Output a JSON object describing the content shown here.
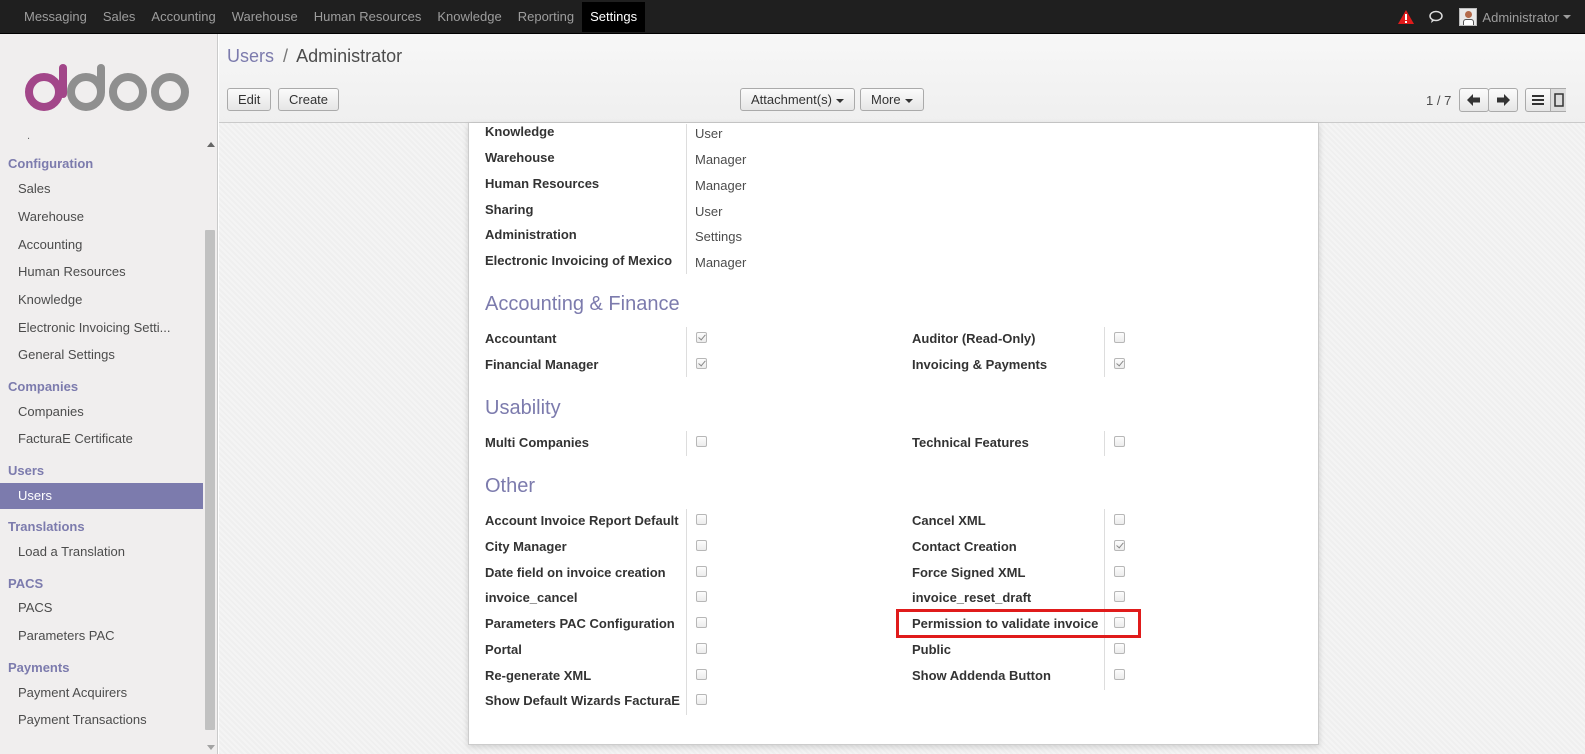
{
  "topbar": {
    "menu": [
      "Messaging",
      "Sales",
      "Accounting",
      "Warehouse",
      "Human Resources",
      "Knowledge",
      "Reporting",
      "Settings"
    ],
    "active": "Settings",
    "user": "Administrator",
    "alert_color": "#e01b1b"
  },
  "sidebar": {
    "logo": "odoo",
    "sections": [
      {
        "title": "Configuration",
        "items": [
          "Sales",
          "Warehouse",
          "Accounting",
          "Human Resources",
          "Knowledge",
          "Electronic Invoicing Setti...",
          "General Settings"
        ]
      },
      {
        "title": "Companies",
        "items": [
          "Companies",
          "FacturaE Certificate"
        ]
      },
      {
        "title": "Users",
        "items": [
          "Users"
        ]
      },
      {
        "title": "Translations",
        "items": [
          "Load a Translation"
        ]
      },
      {
        "title": "PACS",
        "items": [
          "PACS",
          "Parameters PAC"
        ]
      },
      {
        "title": "Payments",
        "items": [
          "Payment Acquirers",
          "Payment Transactions"
        ]
      }
    ],
    "active_item": "Users",
    "accent": "#7c7bad"
  },
  "control": {
    "breadcrumb_parent": "Users",
    "breadcrumb_separator": "/",
    "breadcrumb_current": "Administrator",
    "edit": "Edit",
    "create": "Create",
    "attachments": "Attachment(s)",
    "more": "More",
    "pager": "1 / 7"
  },
  "access_rights": [
    {
      "label": "Knowledge",
      "value": "User"
    },
    {
      "label": "Warehouse",
      "value": "Manager"
    },
    {
      "label": "Human Resources",
      "value": "Manager"
    },
    {
      "label": "Sharing",
      "value": "User"
    },
    {
      "label": "Administration",
      "value": "Settings"
    },
    {
      "label": "Electronic Invoicing of Mexico",
      "value": "Manager"
    }
  ],
  "groups": [
    {
      "title": "Accounting & Finance",
      "rows": [
        [
          {
            "label": "Accountant",
            "checked": true
          },
          {
            "label": "Auditor (Read-Only)",
            "checked": false
          }
        ],
        [
          {
            "label": "Financial Manager",
            "checked": true
          },
          {
            "label": "Invoicing & Payments",
            "checked": true
          }
        ]
      ]
    },
    {
      "title": "Usability",
      "rows": [
        [
          {
            "label": "Multi Companies",
            "checked": false
          },
          {
            "label": "Technical Features",
            "checked": false
          }
        ]
      ]
    },
    {
      "title": "Other",
      "rows": [
        [
          {
            "label": "Account Invoice Report Default",
            "checked": false
          },
          {
            "label": "Cancel XML",
            "checked": false
          }
        ],
        [
          {
            "label": "City Manager",
            "checked": false
          },
          {
            "label": "Contact Creation",
            "checked": true
          }
        ],
        [
          {
            "label": "Date field on invoice creation",
            "checked": false
          },
          {
            "label": "Force Signed XML",
            "checked": false
          }
        ],
        [
          {
            "label": "invoice_cancel",
            "checked": false
          },
          {
            "label": "invoice_reset_draft",
            "checked": false
          }
        ],
        [
          {
            "label": "Parameters PAC Configuration",
            "checked": false
          },
          {
            "label": "Permission to validate invoice",
            "checked": false
          }
        ],
        [
          {
            "label": "Portal",
            "checked": false
          },
          {
            "label": "Public",
            "checked": false
          }
        ],
        [
          {
            "label": "Re-generate XML",
            "checked": false
          },
          {
            "label": "Show Addenda Button",
            "checked": false
          }
        ],
        [
          {
            "label": "Show Default Wizards FacturaE",
            "checked": false
          },
          null
        ]
      ]
    }
  ],
  "highlighted_field": "Permission to validate invoice",
  "highlight_color": "#e01b1b"
}
